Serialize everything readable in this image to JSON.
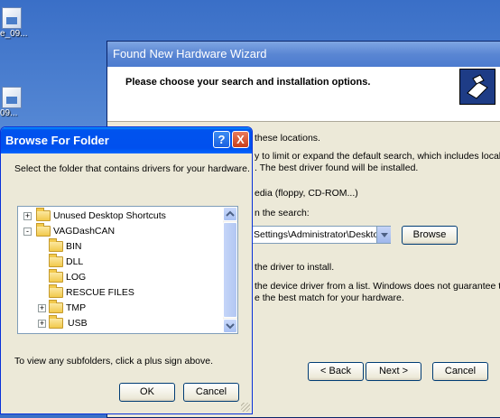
{
  "desktop": {
    "icon1_label": "e_09...",
    "icon2_label": "  09..."
  },
  "wizard": {
    "title": "Found New Hardware Wizard",
    "header": "Please choose your search and installation options.",
    "lines": [
      "these locations.",
      "y to limit or expand the default search, which includes local",
      ". The best driver found will be installed.",
      "edia (floppy, CD-ROM...)",
      "n the search:",
      "the driver to install.",
      "the device driver from a list.  Windows does not guarantee that",
      "e the best match for your hardware."
    ],
    "path_value": "Settings\\Administrator\\Desktop\\",
    "browse_label": "Browse",
    "back_label": "< Back",
    "next_label": "Next >",
    "cancel_label": "Cancel"
  },
  "browse_dialog": {
    "title": "Browse For Folder",
    "help_label": "?",
    "close_label": "X",
    "instruction": "Select the folder that contains drivers for your hardware.",
    "tree": [
      {
        "label": "Unused Desktop Shortcuts",
        "expander": "+"
      },
      {
        "label": "VAGDashCAN",
        "expander": "-"
      },
      {
        "label": "BIN",
        "expander": ""
      },
      {
        "label": "DLL",
        "expander": ""
      },
      {
        "label": "LOG",
        "expander": ""
      },
      {
        "label": "RESCUE FILES",
        "expander": ""
      },
      {
        "label": "TMP",
        "expander": "+"
      },
      {
        "label": "USB",
        "expander": "+"
      }
    ],
    "hint": "To view any subfolders, click a plus sign above.",
    "ok_label": "OK",
    "cancel_label": "Cancel"
  }
}
